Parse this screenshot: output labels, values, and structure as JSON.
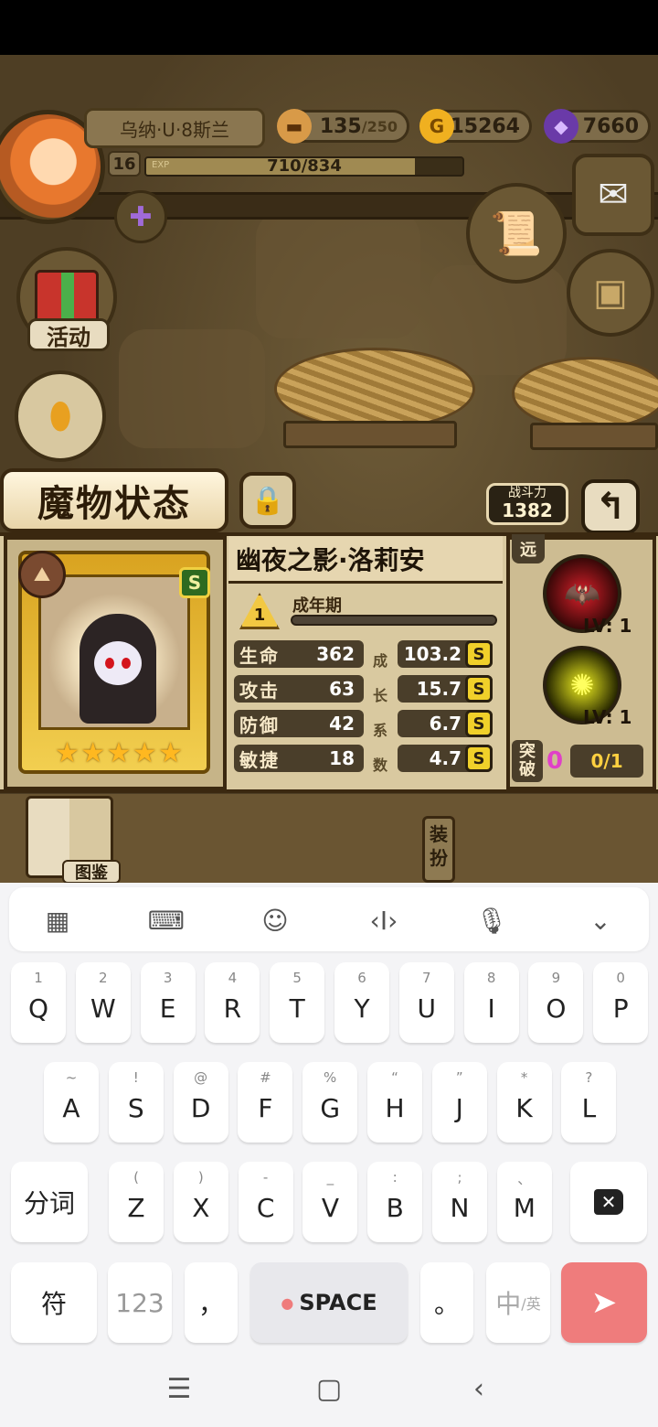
{
  "hud": {
    "player_name": "乌纳·U·8斯兰",
    "stamina": "135",
    "stamina_max": "/250",
    "gold": "15264",
    "gold_icon": "G",
    "gems": "7660",
    "level": "16",
    "exp_label": "EXP",
    "exp_value": "710/834",
    "exp_progress": 0.85
  },
  "side": {
    "activity_label": "活动"
  },
  "monster_screen": {
    "title": "魔物状态",
    "power_label": "战斗力",
    "power_value": "1382",
    "back_icon": "return-arrow-icon"
  },
  "monster": {
    "name": "幽夜之影·洛莉安",
    "rank": "S",
    "stage_num": "1",
    "stage": "成年期",
    "stars": 5,
    "stats": [
      {
        "label": "生命",
        "value": "362",
        "growth": "103.2",
        "grade": "S"
      },
      {
        "label": "攻击",
        "value": "63",
        "growth": "15.7",
        "grade": "S"
      },
      {
        "label": "防御",
        "value": "42",
        "growth": "6.7",
        "grade": "S"
      },
      {
        "label": "敏捷",
        "value": "18",
        "growth": "4.7",
        "grade": "S"
      }
    ],
    "growth_label_chars": [
      "成",
      "长",
      "系",
      "数"
    ],
    "range_tag": "远",
    "skills": [
      {
        "icon": "bat-skill-icon",
        "level": "LV: 1"
      },
      {
        "icon": "yellow-burst-skill-icon",
        "level": "LV: 1"
      }
    ],
    "breakthrough_label": "突破",
    "breakthrough_count": "0",
    "breakthrough_progress": "0/1"
  },
  "bottom": {
    "codex_label": "图鉴",
    "equip_label": "装扮"
  },
  "keyboard": {
    "row1": [
      {
        "sub": "1",
        "main": "Q"
      },
      {
        "sub": "2",
        "main": "W"
      },
      {
        "sub": "3",
        "main": "E"
      },
      {
        "sub": "4",
        "main": "R"
      },
      {
        "sub": "5",
        "main": "T"
      },
      {
        "sub": "6",
        "main": "Y"
      },
      {
        "sub": "7",
        "main": "U"
      },
      {
        "sub": "8",
        "main": "I"
      },
      {
        "sub": "9",
        "main": "O"
      },
      {
        "sub": "0",
        "main": "P"
      }
    ],
    "row2": [
      {
        "sub": "~",
        "main": "A"
      },
      {
        "sub": "!",
        "main": "S"
      },
      {
        "sub": "@",
        "main": "D"
      },
      {
        "sub": "#",
        "main": "F"
      },
      {
        "sub": "%",
        "main": "G"
      },
      {
        "sub": "“",
        "main": "H"
      },
      {
        "sub": "”",
        "main": "J"
      },
      {
        "sub": "*",
        "main": "K"
      },
      {
        "sub": "?",
        "main": "L"
      }
    ],
    "row3": [
      {
        "sub": "(",
        "main": "Z"
      },
      {
        "sub": ")",
        "main": "X"
      },
      {
        "sub": "-",
        "main": "C"
      },
      {
        "sub": "_",
        "main": "V"
      },
      {
        "sub": ":",
        "main": "B"
      },
      {
        "sub": ";",
        "main": "N"
      },
      {
        "sub": "、",
        "main": "M"
      }
    ],
    "segment_label": "分词",
    "symbol_label": "符",
    "num_label": "123",
    "comma_label": "，",
    "space_label": "SPACE",
    "period_label": "。",
    "lang_label_main": "中",
    "lang_label_sub": "/英",
    "enter_color": "#ef7c7c"
  }
}
